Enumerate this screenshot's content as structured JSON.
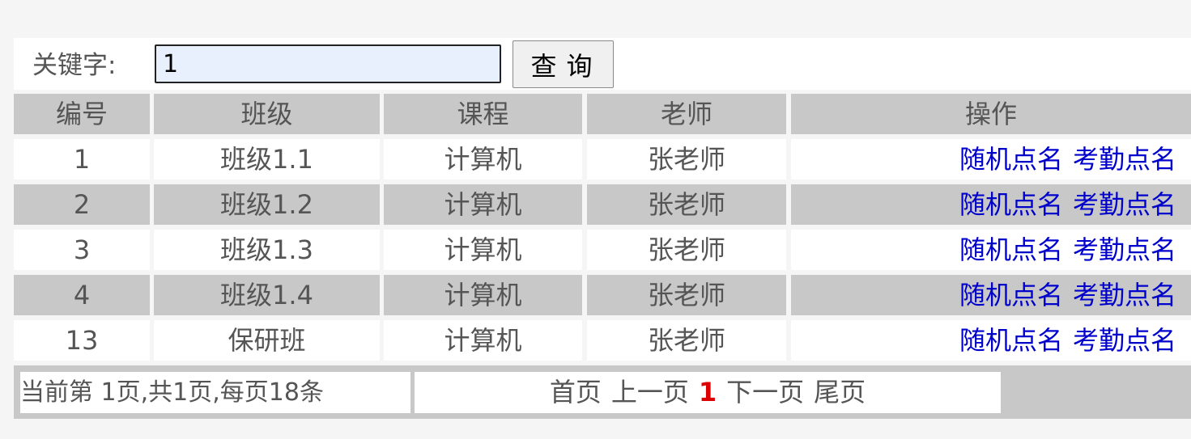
{
  "search": {
    "label": "关键字:",
    "value": "1",
    "button_label": "查询"
  },
  "table": {
    "headers": [
      "编号",
      "班级",
      "课程",
      "老师",
      "操作"
    ],
    "rows": [
      {
        "id": "1",
        "class": "班级1.1",
        "course": "计算机",
        "teacher": "张老师",
        "action1": "随机点名",
        "action2": "考勤点名"
      },
      {
        "id": "2",
        "class": "班级1.2",
        "course": "计算机",
        "teacher": "张老师",
        "action1": "随机点名",
        "action2": "考勤点名"
      },
      {
        "id": "3",
        "class": "班级1.3",
        "course": "计算机",
        "teacher": "张老师",
        "action1": "随机点名",
        "action2": "考勤点名"
      },
      {
        "id": "4",
        "class": "班级1.4",
        "course": "计算机",
        "teacher": "张老师",
        "action1": "随机点名",
        "action2": "考勤点名"
      },
      {
        "id": "13",
        "class": "保研班",
        "course": "计算机",
        "teacher": "张老师",
        "action1": "随机点名",
        "action2": "考勤点名"
      }
    ]
  },
  "pager": {
    "info": "当前第 1页,共1页,每页18条",
    "first": "首页",
    "prev": "上一页",
    "current": "1",
    "next": "下一页",
    "last": "尾页"
  },
  "colors": {
    "header_bg": "#c8c8c8",
    "link": "#0000cc",
    "current_page": "#dd0000",
    "text": "#555555"
  }
}
